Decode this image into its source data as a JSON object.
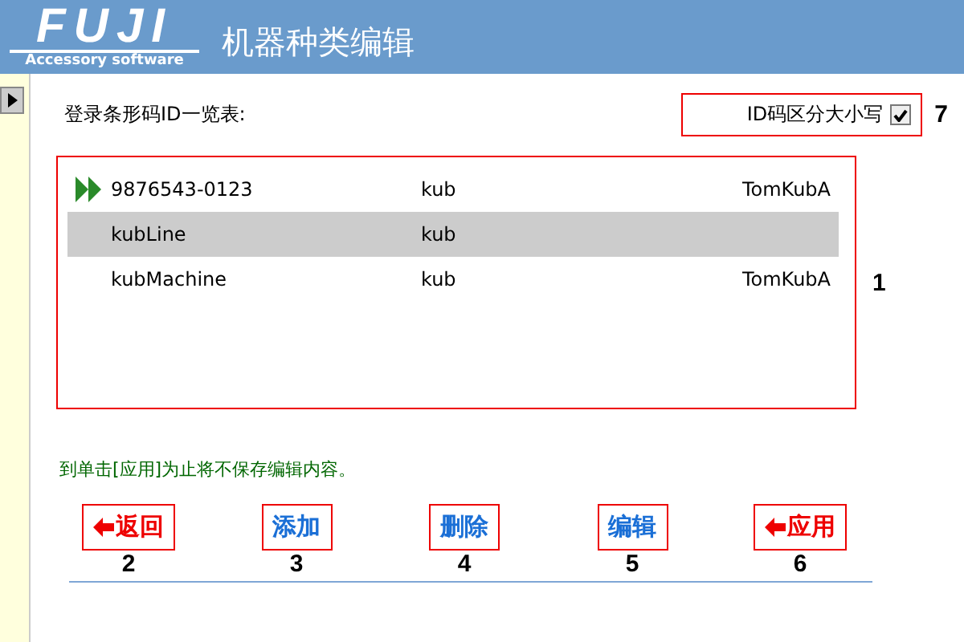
{
  "header": {
    "logo": "FUJI",
    "logo_subtitle": "Accessory software",
    "title": "机器种类编辑"
  },
  "list_label": "登录条形码ID一览表:",
  "case_option": {
    "label": "ID码区分大小写",
    "checked": true,
    "marker": "7"
  },
  "list": {
    "marker": "1",
    "rows": [
      {
        "id": "9876543-0123",
        "type": "kub",
        "owner": "TomKubA",
        "current": true,
        "selected": false
      },
      {
        "id": "kubLine",
        "type": "kub",
        "owner": "",
        "current": false,
        "selected": true
      },
      {
        "id": "kubMachine",
        "type": "kub",
        "owner": "TomKubA",
        "current": false,
        "selected": false
      }
    ]
  },
  "notice": "到单击[应用]为止将不保存编辑内容。",
  "buttons": [
    {
      "label": "返回",
      "kind": "arrow",
      "marker": "2"
    },
    {
      "label": "添加",
      "kind": "plain",
      "marker": "3"
    },
    {
      "label": "删除",
      "kind": "plain",
      "marker": "4"
    },
    {
      "label": "编辑",
      "kind": "plain",
      "marker": "5"
    },
    {
      "label": "应用",
      "kind": "arrow",
      "marker": "6"
    }
  ]
}
